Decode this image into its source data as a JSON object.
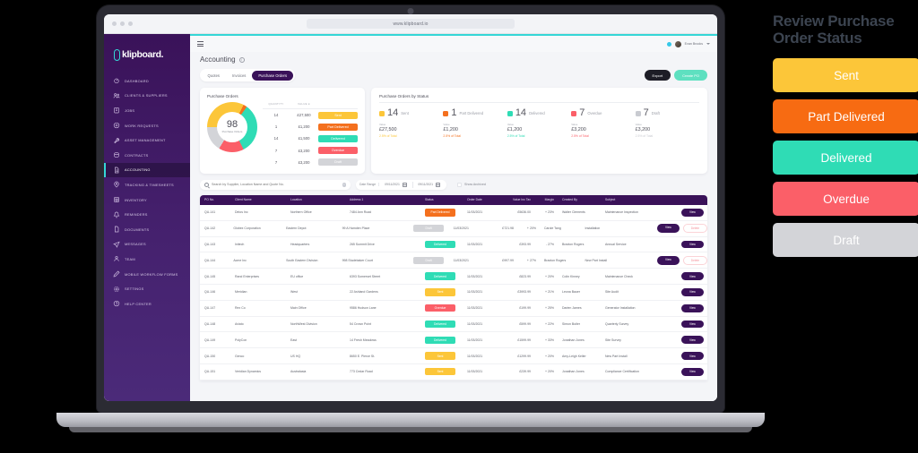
{
  "browser": {
    "url": "www.klipboard.io"
  },
  "brand": {
    "name": "klipboard.",
    "mark": "k-mark-icon"
  },
  "sidebar": {
    "items": [
      {
        "label": "DASHBOARD",
        "icon": "gauge-icon",
        "active": false
      },
      {
        "label": "CLIENTS & SUPPLIERS",
        "icon": "people-icon",
        "active": false
      },
      {
        "label": "JOBS",
        "icon": "clipboard-icon",
        "active": false
      },
      {
        "label": "WORK REQUESTS",
        "icon": "plus-circle-icon",
        "active": false
      },
      {
        "label": "ASSET MANAGEMENT",
        "icon": "wrench-icon",
        "active": false
      },
      {
        "label": "CONTRACTS",
        "icon": "coin-icon",
        "active": false
      },
      {
        "label": "ACCOUNTING",
        "icon": "document-icon",
        "active": true
      },
      {
        "label": "TRACKING & TIMESHEETS",
        "icon": "location-pin-icon",
        "active": false
      },
      {
        "label": "INVENTORY",
        "icon": "grid-icon",
        "active": false
      },
      {
        "label": "REMINDERS",
        "icon": "bell-icon",
        "active": false
      },
      {
        "label": "DOCUMENTS",
        "icon": "file-icon",
        "active": false
      },
      {
        "label": "MESSAGES",
        "icon": "paper-plane-icon",
        "active": false
      },
      {
        "label": "TEAM",
        "icon": "user-icon",
        "active": false
      },
      {
        "label": "MOBILE WORKFLOW FORMS",
        "icon": "pen-icon",
        "active": false
      },
      {
        "label": "SETTINGS",
        "icon": "gear-icon",
        "active": false
      },
      {
        "label": "HELP CENTER",
        "icon": "question-circle-icon",
        "active": false
      }
    ]
  },
  "topbar": {
    "menu_icon": "hamburger-icon",
    "notification_icon": "bell-dot-icon",
    "avatar": "user-avatar",
    "user_name": "Evan Brooks",
    "caret": "chevron-down-icon"
  },
  "page": {
    "title": "Accounting",
    "info_icon": "info-icon"
  },
  "tabs": [
    {
      "label": "Quotes",
      "active": false
    },
    {
      "label": "Invoices",
      "active": false
    },
    {
      "label": "Purchase Orders",
      "active": true
    }
  ],
  "actions": {
    "export_label": "Export",
    "create_label": "Create PO"
  },
  "chart_data": {
    "type": "pie",
    "title": "Purchase Orders",
    "center_value": "98",
    "center_caption": "Purchase Orders",
    "columns": [
      "QUANTITY",
      "VALUE £"
    ],
    "categories": [
      "Sent",
      "Part Delivered",
      "Delivered",
      "Overdue",
      "Draft"
    ],
    "values": [
      14,
      1,
      14,
      7,
      7
    ],
    "amounts": [
      "£27,500",
      "£1,200",
      "£1,500",
      "£3,200",
      "£3,200"
    ],
    "colors": [
      "#fcc639",
      "#f4701e",
      "#2fdcb5",
      "#fb5f68",
      "#d3d4d8"
    ],
    "legend": "right"
  },
  "status_card": {
    "title": "Purchase Orders by Status",
    "value_label": "Value",
    "items": [
      {
        "count": "14",
        "label": "Sent",
        "value": "£27,500",
        "pct": "2.5% of Total",
        "color": "#fcc639"
      },
      {
        "count": "1",
        "label": "Part Delivered",
        "value": "£1,200",
        "pct": "2.5% of Total",
        "color": "#f4701e"
      },
      {
        "count": "14",
        "label": "Delivered",
        "value": "£1,200",
        "pct": "2.5% of Total",
        "color": "#2fdcb5"
      },
      {
        "count": "7",
        "label": "Overdue",
        "value": "£3,200",
        "pct": "2.5% of Total",
        "color": "#fb5f68"
      },
      {
        "count": "7",
        "label": "Draft",
        "value": "£3,200",
        "pct": "2.5% of Total",
        "color": "#c9cbd1"
      }
    ]
  },
  "filters": {
    "search_placeholder": "Search by Supplier, Location Name and Quote No.",
    "search_value": "",
    "search_icon": "search-icon",
    "clear_icon": "clear-icon",
    "date_range_label": "Date Range",
    "date_from": "09/11/2021",
    "date_to": "09/11/2021",
    "calendar_icon": "calendar-icon",
    "archived_label": "Show Archived",
    "archived_checked": false
  },
  "table": {
    "columns": [
      "PO No.",
      "Client Name",
      "Location",
      "Address 1",
      "Status",
      "Order Date",
      "Value Inc Tax",
      "Margin",
      "Created By",
      "Subject",
      ""
    ],
    "view_label": "View",
    "delete_label": "Delete",
    "rows": [
      {
        "po": "QU-141",
        "client": "Delos Inc",
        "location": "Northern Office",
        "address": "7484 Ann Road",
        "status": "Part Delivered",
        "status_color": "#f4701e",
        "date": "11/03/2021",
        "value": "£5636.00",
        "value_sign": "pos",
        "margin": "+ 23%",
        "margin_sign": "pos",
        "creator": "Walter Clements",
        "subject": "Maintenance Inspection",
        "has_delete": false
      },
      {
        "po": "QU-142",
        "client": "Globex Corporation",
        "location": "Eastern Depot",
        "address": "99 A Hamden Place",
        "status": "Draft",
        "status_color": "#d3d4d8",
        "date": "11/03/2021",
        "value": "£721.98",
        "value_sign": "pos",
        "margin": "+ 20%",
        "margin_sign": "pos",
        "creator": "Carole Tang",
        "subject": "Installation",
        "has_delete": true
      },
      {
        "po": "QU-143",
        "client": "Initech",
        "location": "Headquarters",
        "address": "265 Summit Drive",
        "status": "Delivered",
        "status_color": "#2fdcb5",
        "date": "11/03/2021",
        "value": "£393.99",
        "value_sign": "neg",
        "margin": "- 27%",
        "margin_sign": "neg",
        "creator": "Braxton Rogers",
        "subject": "Annual Service",
        "has_delete": false
      },
      {
        "po": "QU-144",
        "client": "Acme Inc",
        "location": "South Eastern Division",
        "address": "998 Studebaker Court",
        "status": "Draft",
        "status_color": "#d3d4d8",
        "date": "11/03/2021",
        "value": "£997.99",
        "value_sign": "pos",
        "margin": "+ 27%",
        "margin_sign": "pos",
        "creator": "Braxton Rogers",
        "subject": "New Part Install",
        "has_delete": true
      },
      {
        "po": "QU-145",
        "client": "Rand Enterprises",
        "location": "EU office",
        "address": "6393 Somerset Street",
        "status": "Delivered",
        "status_color": "#2fdcb5",
        "date": "11/03/2021",
        "value": "£823.99",
        "value_sign": "pos",
        "margin": "+ 20%",
        "margin_sign": "pos",
        "creator": "Colin Kinney",
        "subject": "Maintenance Check",
        "has_delete": false
      },
      {
        "po": "QU-146",
        "client": "Meridian",
        "location": "West",
        "address": "22 Ashland Gardens",
        "status": "Sent",
        "status_color": "#fcc639",
        "date": "11/03/2021",
        "value": "£3993.99",
        "value_sign": "pos",
        "margin": "+ 21%",
        "margin_sign": "pos",
        "creator": "Leona Bauer",
        "subject": "Site Audit",
        "has_delete": false
      },
      {
        "po": "QU-147",
        "client": "Rex Co",
        "location": "Main Office",
        "address": "9586 Hudson Lane",
        "status": "Overdue",
        "status_color": "#fb5f68",
        "date": "11/03/2021",
        "value": "£199.99",
        "value_sign": "pos",
        "margin": "+ 25%",
        "margin_sign": "pos",
        "creator": "Darien James",
        "subject": "Generator Installation",
        "has_delete": false
      },
      {
        "po": "QU-148",
        "client": "Aviato",
        "location": "NorthWest Division",
        "address": "54 Crown Point",
        "status": "Delivered",
        "status_color": "#2fdcb5",
        "date": "11/03/2021",
        "value": "£599.99",
        "value_sign": "pos",
        "margin": "+ 22%",
        "margin_sign": "pos",
        "creator": "Simon Butler",
        "subject": "Quarterly Survey",
        "has_delete": false
      },
      {
        "po": "QU-149",
        "client": "PolyCon",
        "location": "East",
        "address": "14 Fresh Meadows",
        "status": "Delivered",
        "status_color": "#2fdcb5",
        "date": "11/03/2021",
        "value": "£1599.99",
        "value_sign": "pos",
        "margin": "+ 33%",
        "margin_sign": "pos",
        "creator": "Jonathan Jones",
        "subject": "Site Survey",
        "has_delete": false
      },
      {
        "po": "QU-150",
        "client": "Genco",
        "location": "US HQ",
        "address": "8650 E. Pierce St.",
        "status": "Sent",
        "status_color": "#fcc639",
        "date": "11/03/2021",
        "value": "£1299.99",
        "value_sign": "pos",
        "margin": "+ 20%",
        "margin_sign": "pos",
        "creator": "Amy-Leigh Keller",
        "subject": "New Part Install",
        "has_delete": false
      },
      {
        "po": "QU-151",
        "client": "Veridian Dynamics",
        "location": "Australasia",
        "address": "773 Cedar Road",
        "status": "Sent",
        "status_color": "#fcc639",
        "date": "11/03/2021",
        "value": "£239.99",
        "value_sign": "pos",
        "margin": "+ 20%",
        "margin_sign": "pos",
        "creator": "Jonathan Jones",
        "subject": "Compliance Certification",
        "has_delete": false
      }
    ]
  },
  "panel": {
    "title": "Review Purchase Order Status",
    "items": [
      {
        "label": "Sent",
        "color": "#fcc639"
      },
      {
        "label": "Part Delivered",
        "color": "#f76b12"
      },
      {
        "label": "Delivered",
        "color": "#2fdcb5"
      },
      {
        "label": "Overdue",
        "color": "#fb5f68"
      },
      {
        "label": "Draft",
        "color": "#d3d4d8"
      }
    ]
  }
}
